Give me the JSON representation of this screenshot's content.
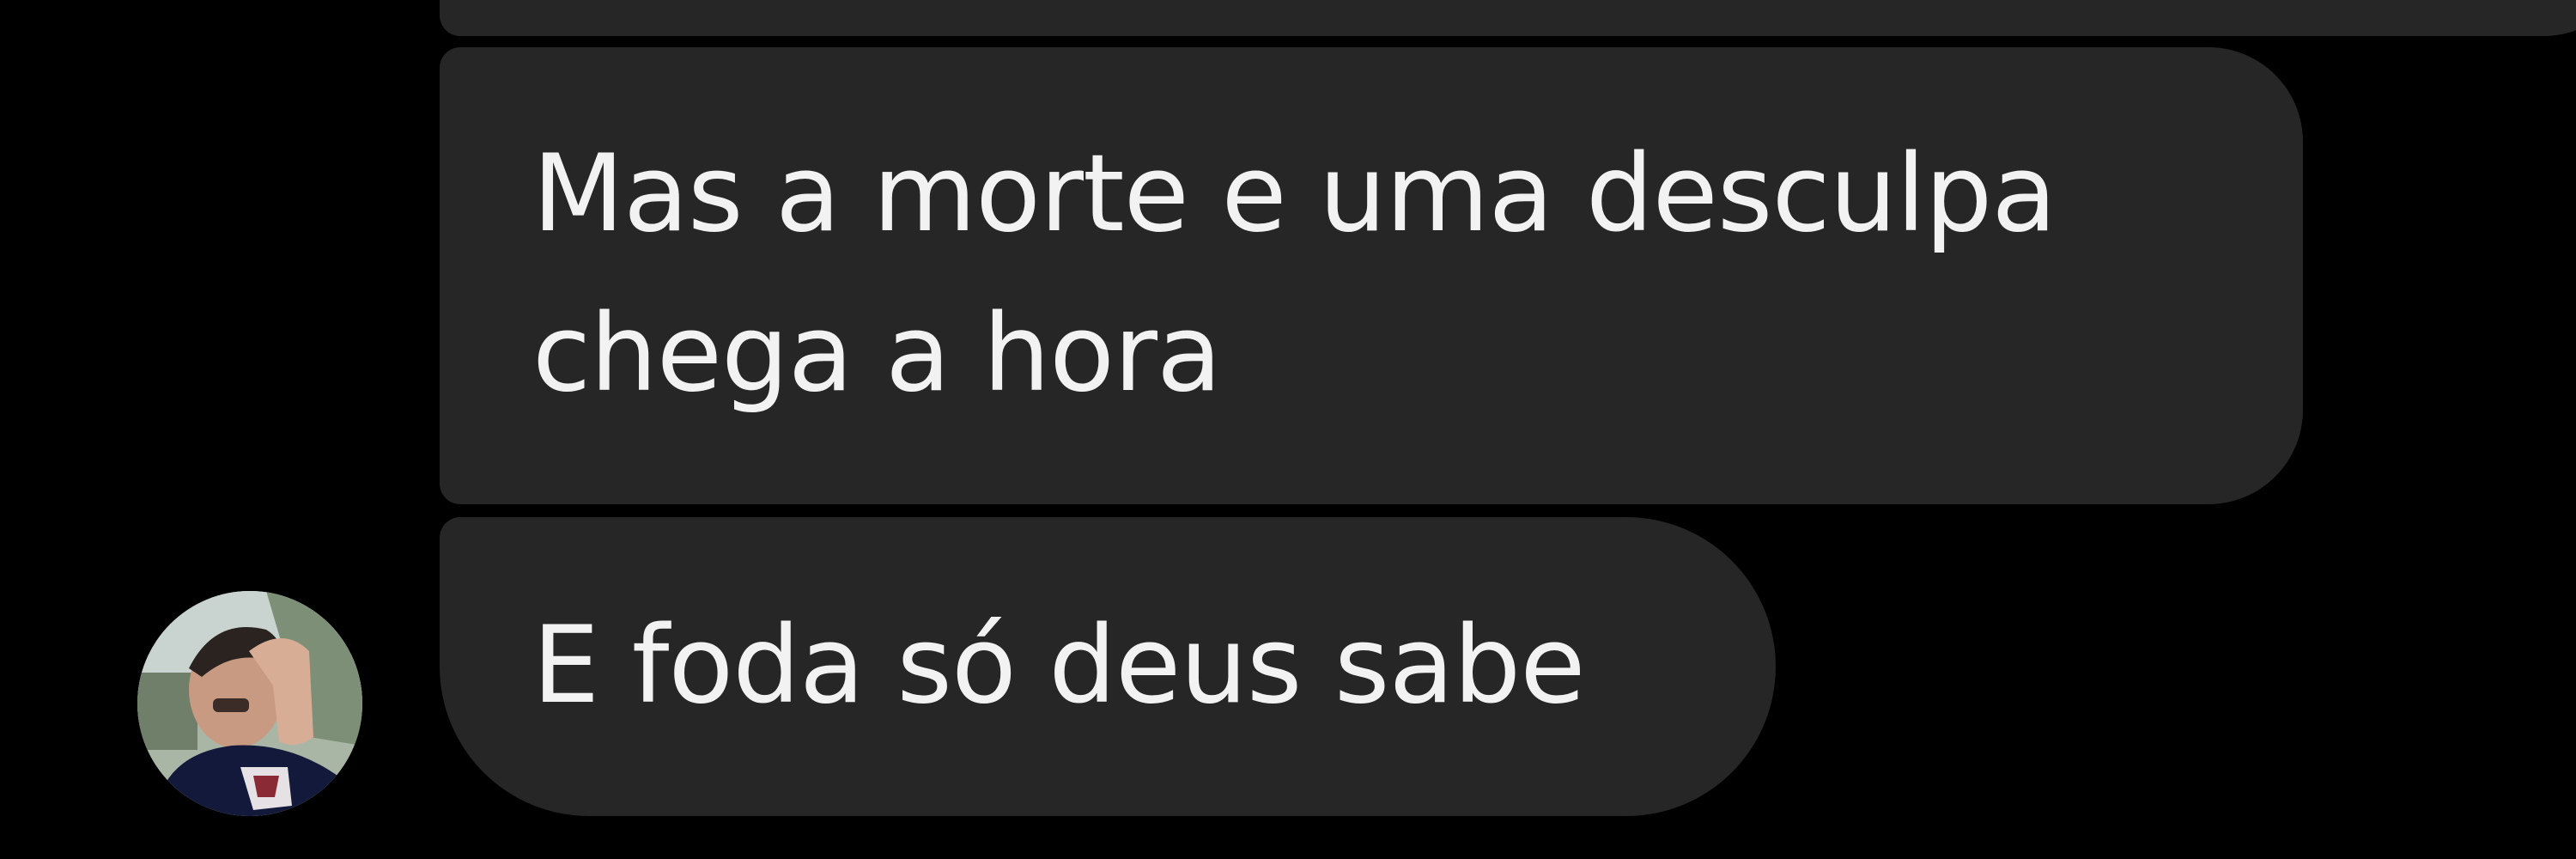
{
  "conversation": {
    "previous_message": {
      "text": ""
    },
    "messages": [
      {
        "lines": [
          "Mas a morte e uma desculpa",
          "chega a hora"
        ]
      },
      {
        "lines": [
          "E foda só deus sabe"
        ]
      }
    ],
    "sender": {
      "avatar_icon": "profile-photo"
    }
  },
  "colors": {
    "background": "#000000",
    "bubble": "#262626",
    "text": "#f2f2f2"
  }
}
